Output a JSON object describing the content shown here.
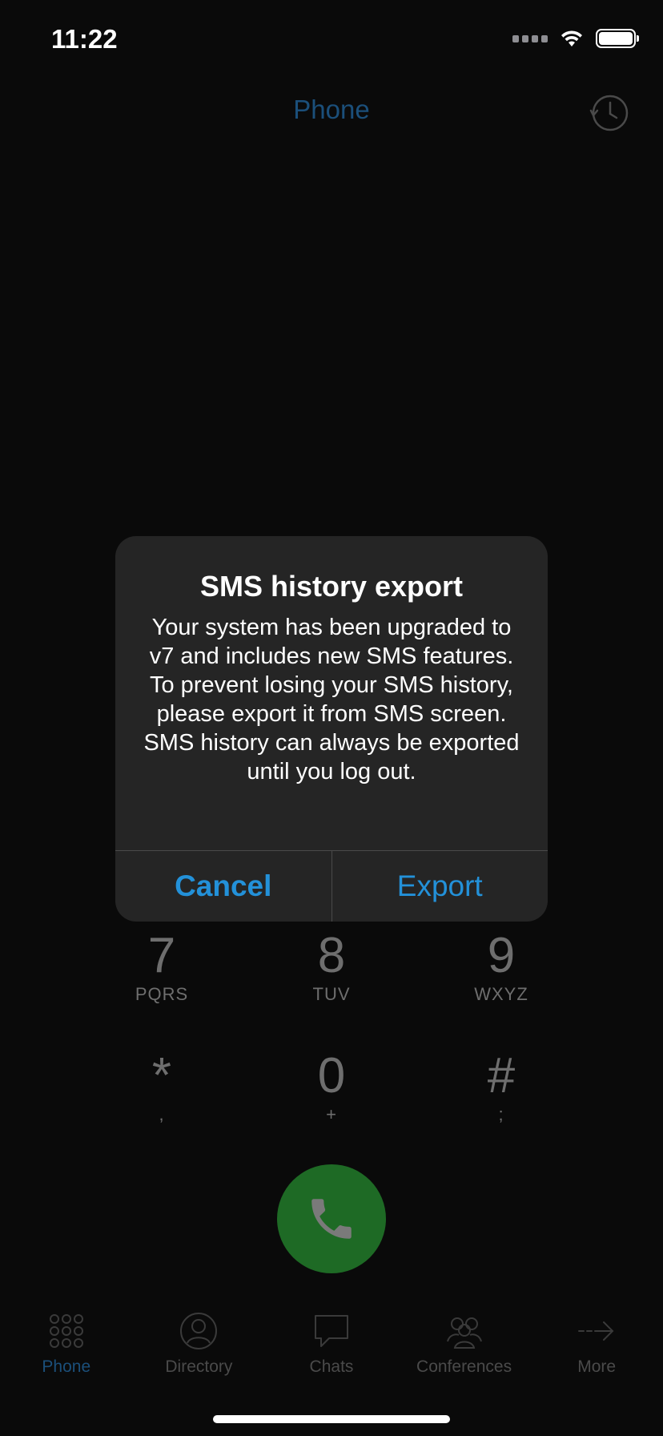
{
  "status_bar": {
    "time": "11:22"
  },
  "header": {
    "title": "Phone"
  },
  "dialpad": {
    "keys": [
      {
        "digit": "7",
        "letters": "PQRS"
      },
      {
        "digit": "8",
        "letters": "TUV"
      },
      {
        "digit": "9",
        "letters": "WXYZ"
      },
      {
        "digit": "*",
        "letters": ","
      },
      {
        "digit": "0",
        "letters": "+"
      },
      {
        "digit": "#",
        "letters": ";"
      }
    ]
  },
  "alert": {
    "title": "SMS history export",
    "message": "Your system has been upgraded to v7 and includes new SMS features. To prevent losing your SMS history, please export it from SMS screen. SMS history can always be exported until you log out.",
    "cancel_label": "Cancel",
    "export_label": "Export"
  },
  "tabs": [
    {
      "label": "Phone",
      "icon": "keypad-icon",
      "active": true
    },
    {
      "label": "Directory",
      "icon": "person-icon",
      "active": false
    },
    {
      "label": "Chats",
      "icon": "chat-bubble-icon",
      "active": false
    },
    {
      "label": "Conferences",
      "icon": "group-icon",
      "active": false
    },
    {
      "label": "More",
      "icon": "arrow-right-icon",
      "active": false
    }
  ],
  "colors": {
    "accent": "#2391d9",
    "call_green": "#1e6a25",
    "alert_bg": "#252525"
  }
}
